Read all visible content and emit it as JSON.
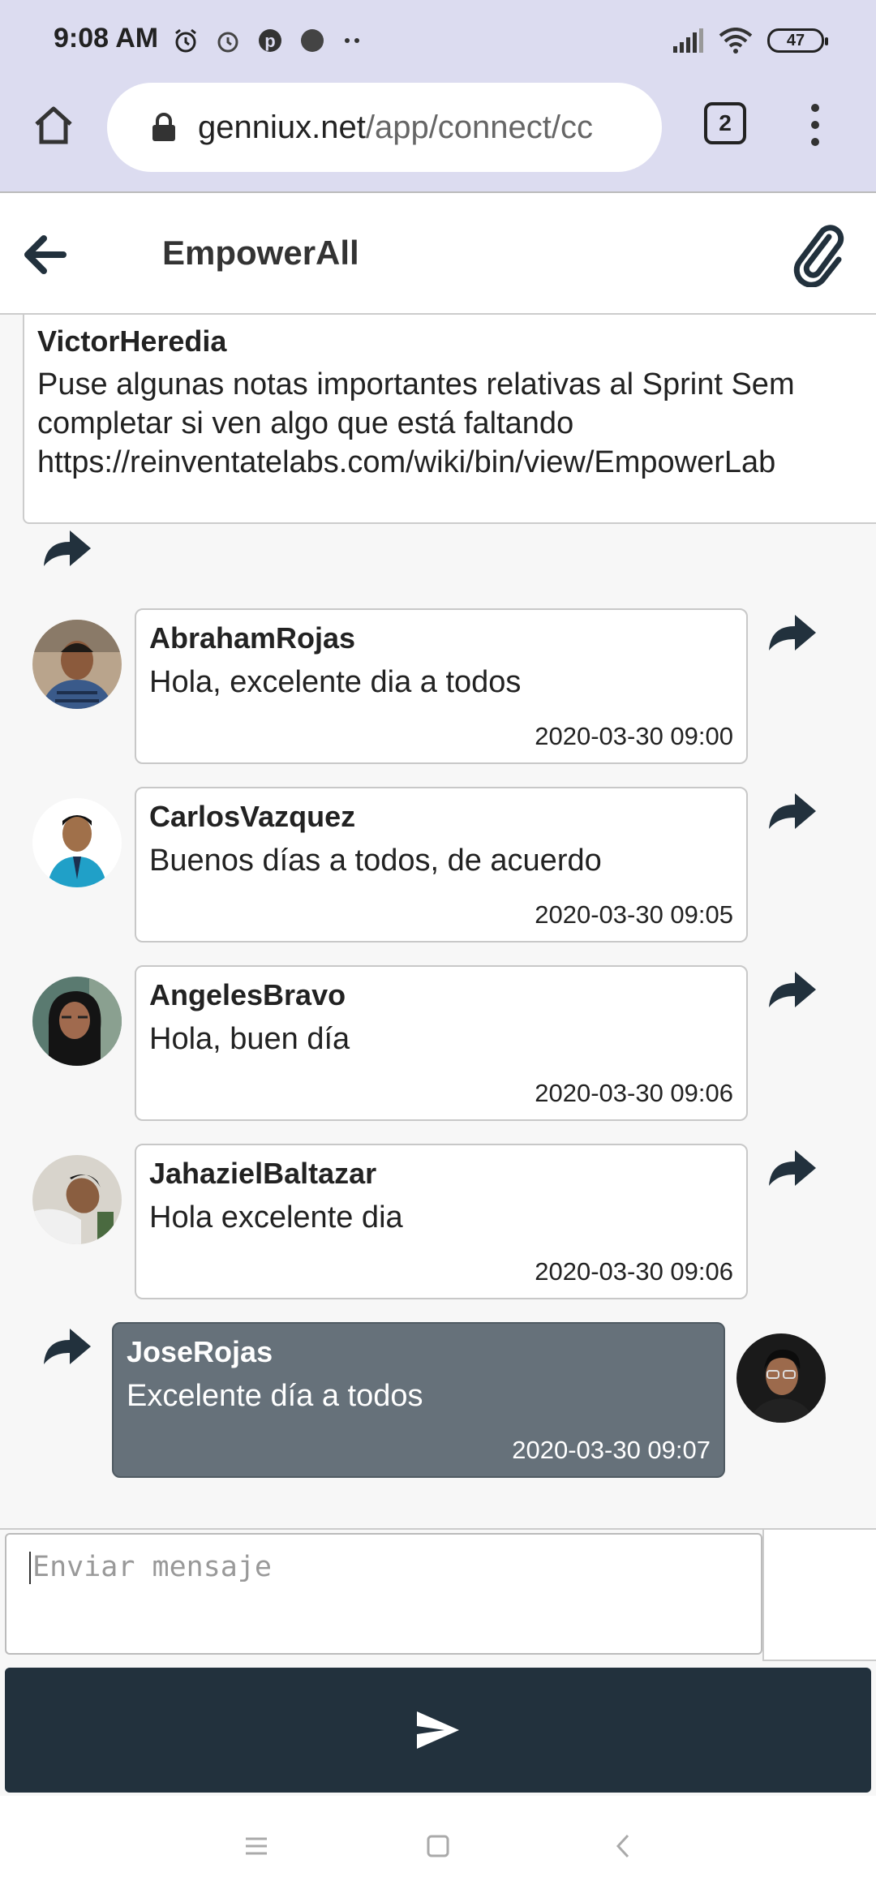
{
  "status_bar": {
    "time": "9:08 AM",
    "battery": "47"
  },
  "browser": {
    "url_host": "genniux.net",
    "url_path": "/app/connect/cc",
    "tab_count": "2"
  },
  "header": {
    "title": "EmpowerAll"
  },
  "partial_message": {
    "author": "VictorHeredia",
    "text": "Puse algunas notas importantes relativas al Sprint Sem\ncompletar si ven algo que está faltando\nhttps://reinventatelabs.com/wiki/bin/view/EmpowerLab"
  },
  "messages": [
    {
      "author": "AbrahamRojas",
      "text": "Hola, excelente dia a todos",
      "timestamp": "2020-03-30 09:00"
    },
    {
      "author": "CarlosVazquez",
      "text": "Buenos días a todos, de acuerdo",
      "timestamp": "2020-03-30 09:05"
    },
    {
      "author": "AngelesBravo",
      "text": "Hola, buen día",
      "timestamp": "2020-03-30 09:06"
    },
    {
      "author": "JahazielBaltazar",
      "text": "Hola excelente dia",
      "timestamp": "2020-03-30 09:06"
    },
    {
      "author": "JoseRojas",
      "text": "Excelente día a todos",
      "timestamp": "2020-03-30 09:07"
    }
  ],
  "composer": {
    "placeholder": "Enviar mensaje"
  },
  "colors": {
    "accent": "#22313d",
    "own_bubble": "#66717a",
    "chrome": "#dcdcf0"
  }
}
